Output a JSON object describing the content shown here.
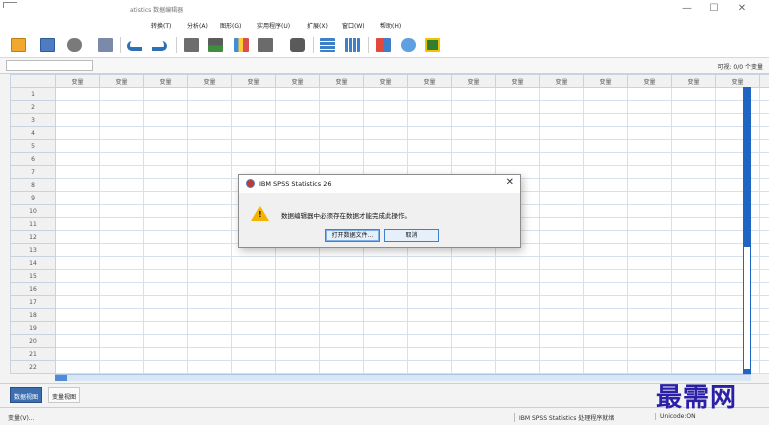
{
  "window": {
    "title": "atistics 数据编辑器",
    "controls": {
      "minimize": "—",
      "maximize": "☐",
      "close": "✕"
    }
  },
  "menu": [
    "转换(T)",
    "分析(A)",
    "图形(G)",
    "实用程序(U)",
    "扩展(X)",
    "窗口(W)",
    "帮助(H)"
  ],
  "variable_bar": {
    "visible_label": "可视: 0/0 个变量"
  },
  "grid": {
    "column_header": "变量",
    "columns": [
      "变量",
      "变量",
      "变量",
      "变量",
      "变量",
      "变量",
      "变量",
      "变量",
      "变量",
      "变量",
      "变量",
      "变量",
      "变量",
      "变量",
      "变量",
      "变量"
    ],
    "last_column_header": "变",
    "rows": [
      "1",
      "2",
      "3",
      "4",
      "5",
      "6",
      "7",
      "8",
      "9",
      "10",
      "11",
      "12",
      "13",
      "14",
      "15",
      "16",
      "17",
      "18",
      "19",
      "20",
      "21",
      "22"
    ]
  },
  "tabs": {
    "data_view": "数据视图",
    "variable_view": "变量视图"
  },
  "status": {
    "left": "变量(V)...",
    "processor": "IBM SPSS Statistics 处理程序就绪",
    "unicode": "Unicode:ON"
  },
  "watermark": "最需网",
  "dialog": {
    "title": "IBM SPSS Statistics 26",
    "close": "✕",
    "warning_mark": "!",
    "message": "数据编辑器中必须存在数据才能完成此操作。",
    "open_button": "打开数据文件...",
    "cancel_button": "取消"
  },
  "colors": {
    "accent": "#3d6fb0",
    "scroll": "#1f66c4",
    "warning": "#f5b400",
    "watermark": "#2a1fa6"
  }
}
